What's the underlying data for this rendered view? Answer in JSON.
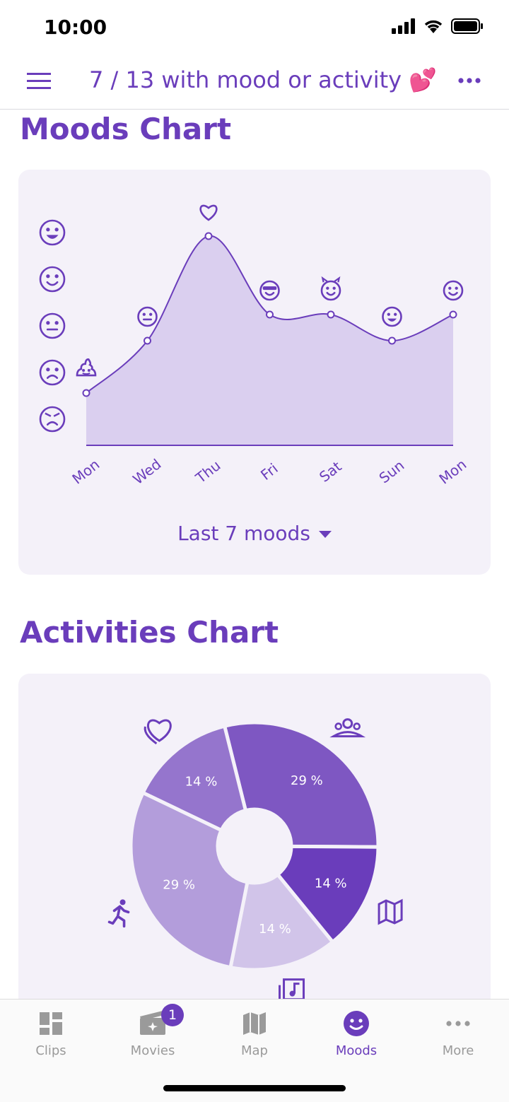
{
  "status_bar": {
    "time": "10:00"
  },
  "header": {
    "title": "7 / 13 with mood or activity 💕"
  },
  "moods_section": {
    "title": "Moods Chart",
    "range_label": "Last 7 moods",
    "y_levels": [
      "very-happy-face-icon",
      "happy-face-icon",
      "neutral-face-icon",
      "sad-face-icon",
      "angry-face-icon"
    ]
  },
  "activities_section": {
    "title": "Activities Chart"
  },
  "chart_data": [
    {
      "type": "area",
      "title": "Moods Chart",
      "categories": [
        "Mon",
        "Wed",
        "Thu",
        "Fri",
        "Sat",
        "Sun",
        "Mon"
      ],
      "values": [
        1,
        2,
        4,
        2.5,
        2.5,
        2,
        2.5
      ],
      "ylim": [
        0,
        5
      ],
      "point_icons": [
        "poop-icon",
        "neutral-face-icon",
        "heart-icon",
        "sunglasses-face-icon",
        "devil-face-icon",
        "baby-face-icon",
        "smile-face-icon"
      ],
      "colors": {
        "line": "#6a3dbb",
        "fill": "#dacfef"
      }
    },
    {
      "type": "pie",
      "title": "Activities Chart",
      "slices": [
        {
          "icon": "people-icon",
          "value": 29,
          "label": "29 %",
          "color": "#7e57c2"
        },
        {
          "icon": "map-icon",
          "value": 14,
          "label": "14 %",
          "color": "#6a3dbb"
        },
        {
          "icon": "music-library-icon",
          "value": 14,
          "label": "14 %",
          "color": "#d1c4e9"
        },
        {
          "icon": "running-icon",
          "value": 29,
          "label": "29 %",
          "color": "#b39ddb"
        },
        {
          "icon": "heart-icon",
          "value": 14,
          "label": "14 %",
          "color": "#9575cd"
        }
      ]
    }
  ],
  "tabs": [
    {
      "label": "Clips",
      "icon": "clips-icon"
    },
    {
      "label": "Movies",
      "icon": "movies-icon",
      "badge": "1"
    },
    {
      "label": "Map",
      "icon": "map-icon"
    },
    {
      "label": "Moods",
      "icon": "mood-icon",
      "active": true
    },
    {
      "label": "More",
      "icon": "more-icon"
    }
  ]
}
